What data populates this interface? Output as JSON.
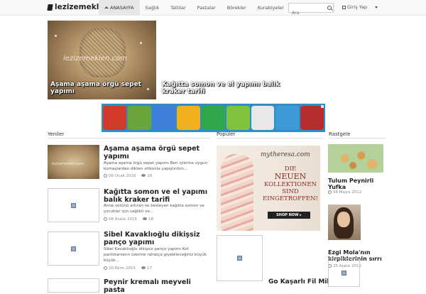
{
  "site": {
    "brand": "lezizemekler"
  },
  "nav": {
    "items": [
      {
        "label": "ANASAYFA",
        "active": true
      },
      {
        "label": "Sağlık"
      },
      {
        "label": "Tatlılar"
      },
      {
        "label": "Pastalar"
      },
      {
        "label": "Börekler"
      },
      {
        "label": "Kurabiyeler"
      }
    ],
    "search_placeholder": "Ara",
    "login_label": "Giriş Yap"
  },
  "featured": [
    {
      "caption": "Aşama aşama örgü sepet yapımı",
      "watermark": "lezizemeklen.com"
    },
    {
      "caption": "Kağıtta somon ve el yapımı balık kraker tarifi"
    }
  ],
  "sections": {
    "recent": "Yeniler",
    "popular": "Popüler",
    "random": "Rastgele"
  },
  "articles": [
    {
      "title": "Aşama aşama örgü sepet yapımı",
      "excerpt": "Aşama aşama örgü sepet yapımı Ben içlerine uygun kumaşlardan dikten silikonla yapıştırdım...",
      "date": "06 Ocak 2016",
      "views": "16",
      "thumb_watermark": "lezizemeklen.com"
    },
    {
      "title": "Kağıtta somon ve el yapımı balık kraker tarifi",
      "excerpt": "Anne sütünü artıran ve besleyen kağıtta somon ve çocuklar için sağlıklı ve...",
      "date": "08 Aralık 2015",
      "views": "18"
    },
    {
      "title": "Sibel Kavaklıoğlu dikişsiz panço yapımı",
      "excerpt": "Sibel Kavaklıoğlu dikişsiz panço yapımı Kot pantolanların üzerine rahatça giyebileceğiniz büyük küçük...",
      "date": "20 Ekim 2015",
      "views": "17"
    },
    {
      "title": "Peynir kremalı meyveli pasta"
    }
  ],
  "ad": {
    "brand": "mytheresa.com",
    "line1": "DIE",
    "line2": "NEUEN",
    "line3": "KOLLEKTIONEN",
    "line4": "SIND",
    "line5": "EINGETROFFEN!",
    "cta": "SHOP NOW ▸"
  },
  "random": [
    {
      "title": "Tulum Peynirli Yufka",
      "date": "08 Mayıs 2012"
    },
    {
      "title": "Ezgi Mola'nın kirpiklerinin sırrı",
      "date": "25 Aralık 2012"
    }
  ],
  "popular_cut_title": "Go Kaşarlı Fil Mil",
  "banner_tiles": [
    "#d23b2b",
    "#6aa43a",
    "#3f7ed8",
    "#f2b01f",
    "#2fa84b",
    "#7fc23c",
    "#e8e8e8",
    "#3d9ad6",
    "#b52d2d"
  ]
}
